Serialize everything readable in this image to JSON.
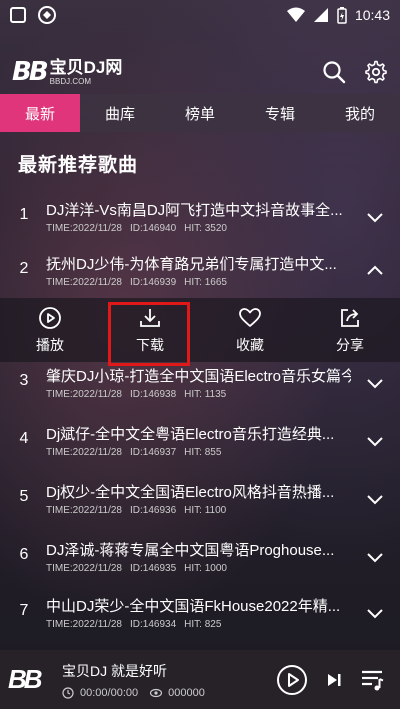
{
  "status": {
    "time": "10:43"
  },
  "header": {
    "brand": "宝贝DJ网",
    "brand_sub": "BBDJ.COM",
    "logo_mark": "BB"
  },
  "tabs": [
    {
      "label": "最新",
      "active": true
    },
    {
      "label": "曲库"
    },
    {
      "label": "榜单"
    },
    {
      "label": "专辑"
    },
    {
      "label": "我的"
    }
  ],
  "section_title": "最新推荐歌曲",
  "songs": [
    {
      "num": "1",
      "title": "DJ洋洋-Vs南昌DJ阿飞打造中文抖音故事全...",
      "time": "TIME:2022/11/28",
      "id": "ID:146940",
      "hit": "HIT: 3520",
      "expanded": false
    },
    {
      "num": "2",
      "title": "抚州DJ少伟-为体育路兄弟们专属打造中文...",
      "time": "TIME:2022/11/28",
      "id": "ID:146939",
      "hit": "HIT: 1665",
      "expanded": true
    },
    {
      "num": "3",
      "title": "肇庆DJ小琼-打造全中文国语Electro音乐女篇今...",
      "time": "TIME:2022/11/28",
      "id": "ID:146938",
      "hit": "HIT: 1135",
      "expanded": false
    },
    {
      "num": "4",
      "title": "Dj斌仔-全中文全粤语Electro音乐打造经典...",
      "time": "TIME:2022/11/28",
      "id": "ID:146937",
      "hit": "HIT: 855",
      "expanded": false
    },
    {
      "num": "5",
      "title": "Dj权少-全中文全国语Electro风格抖音热播...",
      "time": "TIME:2022/11/28",
      "id": "ID:146936",
      "hit": "HIT: 1100",
      "expanded": false
    },
    {
      "num": "6",
      "title": "DJ泽诚-蒋蒋专属全中文国粤语Proghouse...",
      "time": "TIME:2022/11/28",
      "id": "ID:146935",
      "hit": "HIT: 1000",
      "expanded": false
    },
    {
      "num": "7",
      "title": "中山DJ荣少-全中文国语FkHouse2022年精...",
      "time": "TIME:2022/11/28",
      "id": "ID:146934",
      "hit": "HIT: 825",
      "expanded": false
    }
  ],
  "actions": [
    {
      "label": "播放",
      "icon": "play-circle-icon"
    },
    {
      "label": "下载",
      "icon": "download-icon"
    },
    {
      "label": "收藏",
      "icon": "heart-icon"
    },
    {
      "label": "分享",
      "icon": "share-icon"
    }
  ],
  "player": {
    "title": "宝贝DJ 就是好听",
    "time": "00:00/00:00",
    "count": "000000"
  },
  "colors": {
    "accent": "#e0357a",
    "highlight": "#e01818"
  }
}
